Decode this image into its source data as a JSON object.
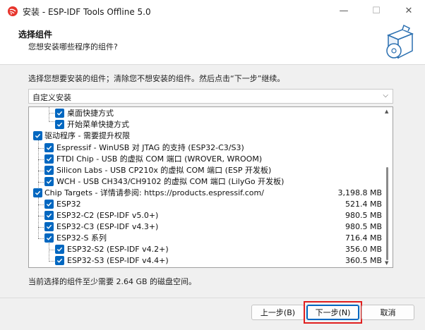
{
  "window": {
    "title": "安装 - ESP-IDF Tools Offline 5.0",
    "minimize_glyph": "—",
    "maximize_glyph": "☐",
    "close_glyph": "✕"
  },
  "header": {
    "title": "选择组件",
    "subtitle": "您想安装哪些程序的组件?"
  },
  "instruction": "选择您想要安装的组件；清除您不想安装的组件。然后点击“下一步”继续。",
  "install_type": {
    "selected": "自定义安装",
    "chevron": "⌵"
  },
  "components": [
    {
      "label": "桌面快捷方式",
      "size": ""
    },
    {
      "label": "开始菜单快捷方式",
      "size": ""
    },
    {
      "label": "驱动程序 - 需要提升权限",
      "size": ""
    },
    {
      "label": "Espressif - WinUSB 对 JTAG 的支持 (ESP32-C3/S3)",
      "size": ""
    },
    {
      "label": "FTDI Chip - USB 的虚拟 COM 端口 (WROVER, WROOM)",
      "size": ""
    },
    {
      "label": "Silicon Labs - USB CP210x 的虚拟 COM 端口 (ESP 开发板)",
      "size": ""
    },
    {
      "label": "WCH - USB CH343/CH9102 的虚拟 COM 端口 (LilyGo 开发板)",
      "size": ""
    },
    {
      "label": "Chip Targets - 详情请参阅: https://products.espressif.com/",
      "size": "3,198.8 MB"
    },
    {
      "label": "ESP32",
      "size": "521.4 MB"
    },
    {
      "label": "ESP32-C2 (ESP-IDF v5.0+)",
      "size": "980.5 MB"
    },
    {
      "label": "ESP32-C3 (ESP-IDF v4.3+)",
      "size": "980.5 MB"
    },
    {
      "label": "ESP32-S 系列",
      "size": "716.4 MB"
    },
    {
      "label": "ESP32-S2 (ESP-IDF v4.2+)",
      "size": "356.0 MB"
    },
    {
      "label": "ESP32-S3 (ESP-IDF v4.4+)",
      "size": "360.5 MB"
    }
  ],
  "space_note": "当前选择的组件至少需要 2.64 GB 的磁盘空间。",
  "buttons": {
    "back": "上一步(B)",
    "next": "下一步(N)",
    "cancel": "取消"
  },
  "colors": {
    "accent": "#0067c0",
    "highlight": "#e02020"
  }
}
